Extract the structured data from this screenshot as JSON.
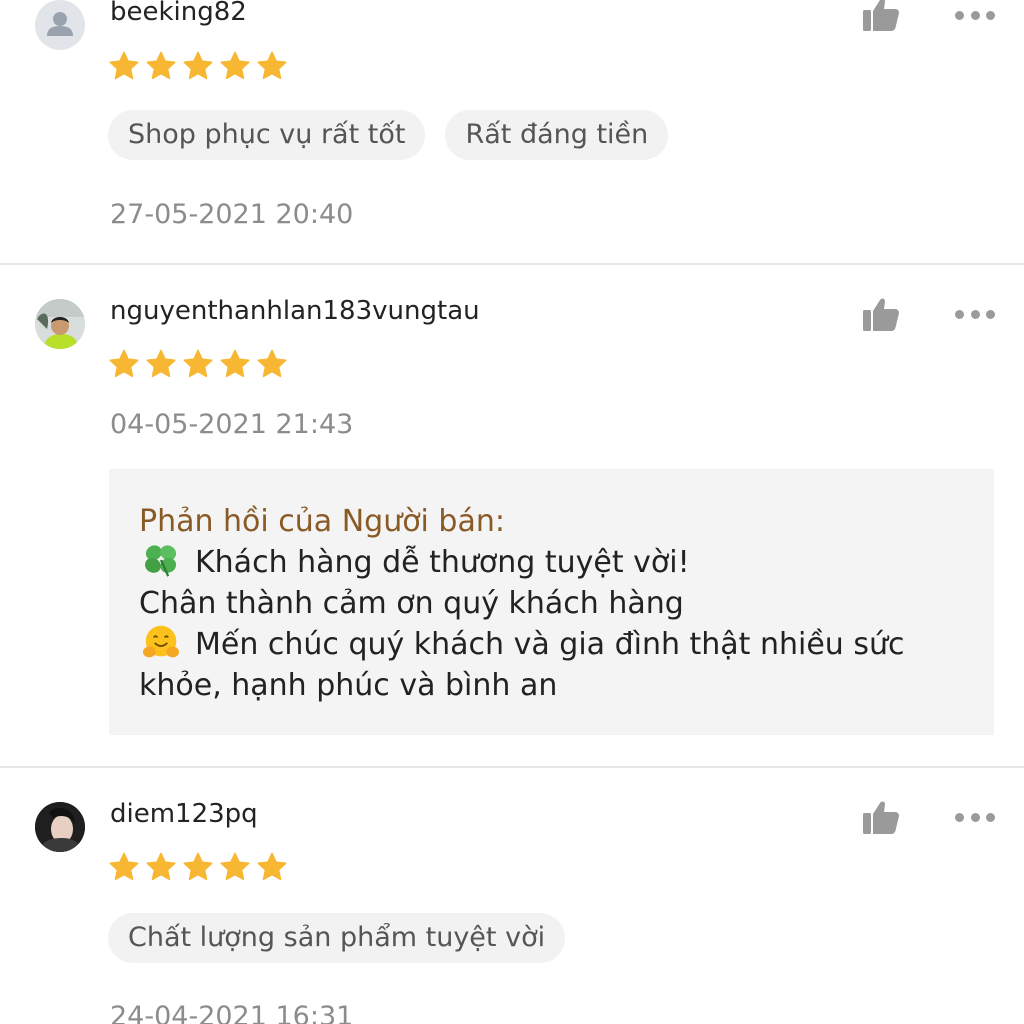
{
  "reviews": [
    {
      "username": "beeking82",
      "rating": 5,
      "tags": [
        "Shop phục vụ rất tốt",
        "Rất đáng tiền"
      ],
      "date": "27-05-2021 20:40",
      "avatar": "default-user-avatar"
    },
    {
      "username": "nguyenthanhlan183vungtau",
      "rating": 5,
      "date": "04-05-2021 21:43",
      "avatar": "user-photo-avatar",
      "seller_reply": {
        "title": "Phản hồi của Người bán:",
        "line1": "Khách hàng dễ thương tuyệt vời!",
        "line1_emoji": "four-leaf-clover",
        "line2": "Chân thành cảm ơn quý khách hàng",
        "line3": "Mến chúc quý khách và gia đình thật nhiều sức",
        "line3_emoji": "hugging-face",
        "line4": "khỏe, hạnh phúc và bình an"
      }
    },
    {
      "username": "diem123pq",
      "rating": 5,
      "tags": [
        "Chất lượng sản phẩm tuyệt vời"
      ],
      "date": "24-04-2021 16:31",
      "avatar": "user-photo-avatar"
    }
  ],
  "colors": {
    "star": "#f7b733",
    "reply_title": "#8a5a26",
    "tag_bg": "#f2f2f2",
    "date": "#8c8c8c",
    "icon": "#9a9a9a"
  }
}
